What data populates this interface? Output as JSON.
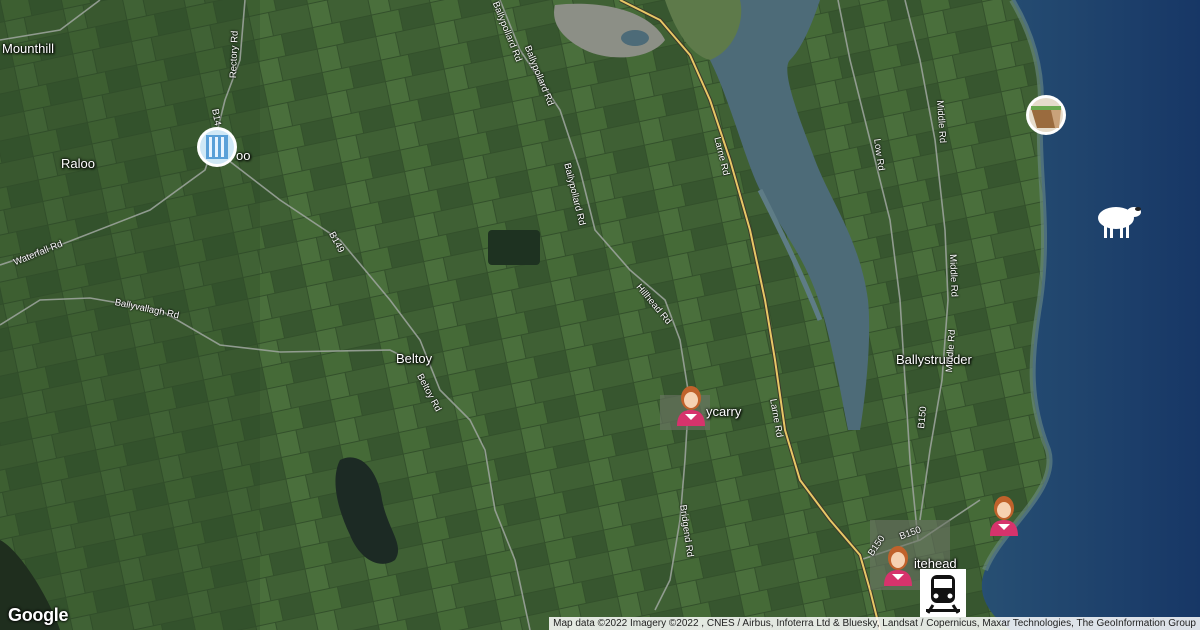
{
  "map": {
    "places": [
      {
        "key": "mounthill",
        "label": "Mounthill"
      },
      {
        "key": "raloo",
        "label": "Raloo"
      },
      {
        "key": "raloo-tail",
        "label": "oo"
      },
      {
        "key": "beltoy",
        "label": "Beltoy"
      },
      {
        "key": "ballycarry",
        "label": "ycarry"
      },
      {
        "key": "ballystrudder",
        "label": "Ballystrudder"
      },
      {
        "key": "whitehead",
        "label": "itehead"
      }
    ],
    "roads": [
      {
        "key": "rectory-rd",
        "label": "Rectory Rd"
      },
      {
        "key": "b14",
        "label": "B14"
      },
      {
        "key": "waterfall-rd",
        "label": "Waterfall Rd"
      },
      {
        "key": "b149",
        "label": "B149"
      },
      {
        "key": "ballyvallagh-rd",
        "label": "Ballyvallagh Rd"
      },
      {
        "key": "beltoy-rd",
        "label": "Beltoy Rd"
      },
      {
        "key": "ballypollard-rd-1",
        "label": "Ballypollard Rd"
      },
      {
        "key": "ballypollard-rd-2",
        "label": "Ballypollard Rd"
      },
      {
        "key": "ballypollard-rd-3",
        "label": "Ballypollard Rd"
      },
      {
        "key": "hillhead-rd",
        "label": "Hillhead Rd"
      },
      {
        "key": "larne-rd-1",
        "label": "Larne Rd"
      },
      {
        "key": "larne-rd-2",
        "label": "Larne Rd"
      },
      {
        "key": "bridgend-rd",
        "label": "Bridgend Rd"
      },
      {
        "key": "low-rd",
        "label": "Low Rd"
      },
      {
        "key": "middle-rd-1",
        "label": "Middle Rd"
      },
      {
        "key": "middle-rd-2",
        "label": "Middle Rd"
      },
      {
        "key": "middle-rd-3",
        "label": "Middle Rd"
      },
      {
        "key": "b150-1",
        "label": "B150"
      },
      {
        "key": "b150-2",
        "label": "B150"
      },
      {
        "key": "b150-3",
        "label": "B150"
      }
    ],
    "markers": [
      {
        "key": "waterfall",
        "icon": "waterfall-icon"
      },
      {
        "key": "coastal-cliff",
        "icon": "cliff-icon"
      },
      {
        "key": "sheep",
        "icon": "sheep-icon"
      },
      {
        "key": "person-ballycarry",
        "icon": "person-icon"
      },
      {
        "key": "person-whitehead",
        "icon": "person-icon"
      },
      {
        "key": "person-coast",
        "icon": "person-icon"
      },
      {
        "key": "train-station",
        "icon": "train-icon"
      }
    ],
    "google_logo": "Google",
    "attribution": "Map data ©2022 Imagery ©2022 , CNES / Airbus, Infoterra Ltd & Bluesky, Landsat / Copernicus, Maxar Technologies, The GeoInformation Group",
    "colors": {
      "land": "#3a5a32",
      "sea": "#1d3f6b",
      "lough": "#4d6b78",
      "main_road": "#e8c766",
      "minor_road": "#9aa39a"
    }
  }
}
